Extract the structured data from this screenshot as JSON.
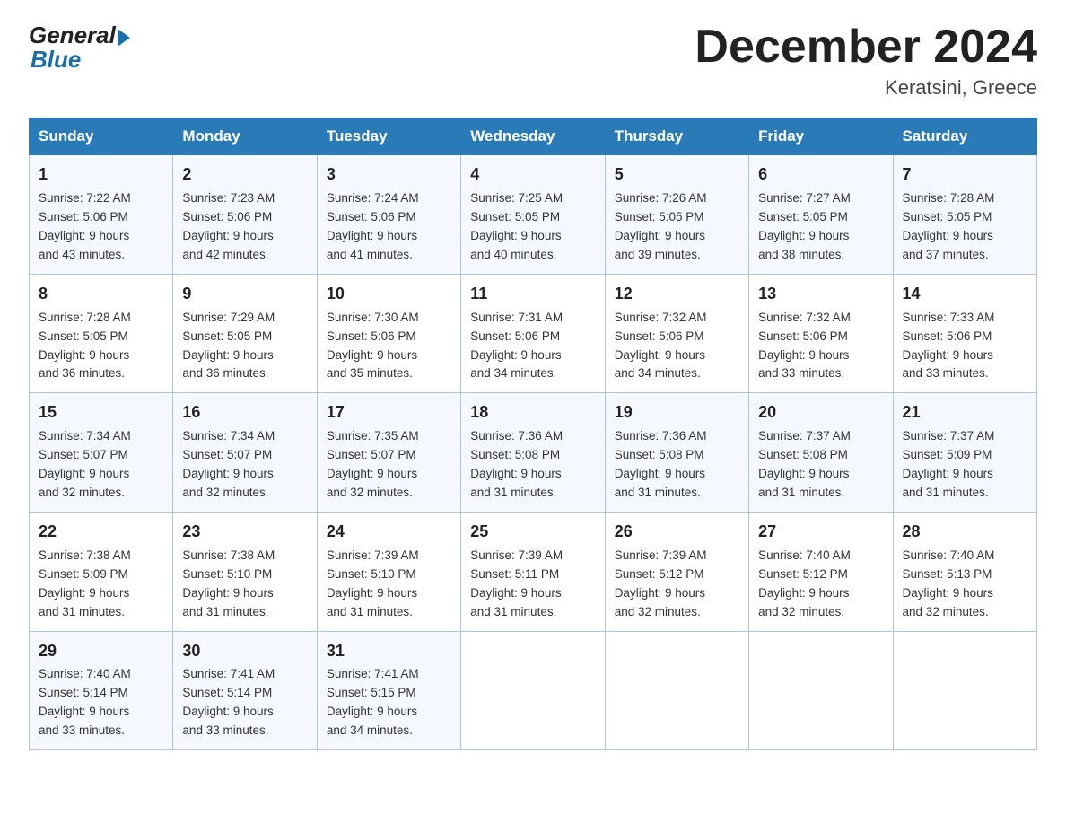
{
  "header": {
    "logo_general": "General",
    "logo_blue": "Blue",
    "month_title": "December 2024",
    "location": "Keratsini, Greece"
  },
  "days_of_week": [
    "Sunday",
    "Monday",
    "Tuesday",
    "Wednesday",
    "Thursday",
    "Friday",
    "Saturday"
  ],
  "weeks": [
    [
      {
        "day": "1",
        "sunrise": "7:22 AM",
        "sunset": "5:06 PM",
        "daylight": "9 hours and 43 minutes."
      },
      {
        "day": "2",
        "sunrise": "7:23 AM",
        "sunset": "5:06 PM",
        "daylight": "9 hours and 42 minutes."
      },
      {
        "day": "3",
        "sunrise": "7:24 AM",
        "sunset": "5:06 PM",
        "daylight": "9 hours and 41 minutes."
      },
      {
        "day": "4",
        "sunrise": "7:25 AM",
        "sunset": "5:05 PM",
        "daylight": "9 hours and 40 minutes."
      },
      {
        "day": "5",
        "sunrise": "7:26 AM",
        "sunset": "5:05 PM",
        "daylight": "9 hours and 39 minutes."
      },
      {
        "day": "6",
        "sunrise": "7:27 AM",
        "sunset": "5:05 PM",
        "daylight": "9 hours and 38 minutes."
      },
      {
        "day": "7",
        "sunrise": "7:28 AM",
        "sunset": "5:05 PM",
        "daylight": "9 hours and 37 minutes."
      }
    ],
    [
      {
        "day": "8",
        "sunrise": "7:28 AM",
        "sunset": "5:05 PM",
        "daylight": "9 hours and 36 minutes."
      },
      {
        "day": "9",
        "sunrise": "7:29 AM",
        "sunset": "5:05 PM",
        "daylight": "9 hours and 36 minutes."
      },
      {
        "day": "10",
        "sunrise": "7:30 AM",
        "sunset": "5:06 PM",
        "daylight": "9 hours and 35 minutes."
      },
      {
        "day": "11",
        "sunrise": "7:31 AM",
        "sunset": "5:06 PM",
        "daylight": "9 hours and 34 minutes."
      },
      {
        "day": "12",
        "sunrise": "7:32 AM",
        "sunset": "5:06 PM",
        "daylight": "9 hours and 34 minutes."
      },
      {
        "day": "13",
        "sunrise": "7:32 AM",
        "sunset": "5:06 PM",
        "daylight": "9 hours and 33 minutes."
      },
      {
        "day": "14",
        "sunrise": "7:33 AM",
        "sunset": "5:06 PM",
        "daylight": "9 hours and 33 minutes."
      }
    ],
    [
      {
        "day": "15",
        "sunrise": "7:34 AM",
        "sunset": "5:07 PM",
        "daylight": "9 hours and 32 minutes."
      },
      {
        "day": "16",
        "sunrise": "7:34 AM",
        "sunset": "5:07 PM",
        "daylight": "9 hours and 32 minutes."
      },
      {
        "day": "17",
        "sunrise": "7:35 AM",
        "sunset": "5:07 PM",
        "daylight": "9 hours and 32 minutes."
      },
      {
        "day": "18",
        "sunrise": "7:36 AM",
        "sunset": "5:08 PM",
        "daylight": "9 hours and 31 minutes."
      },
      {
        "day": "19",
        "sunrise": "7:36 AM",
        "sunset": "5:08 PM",
        "daylight": "9 hours and 31 minutes."
      },
      {
        "day": "20",
        "sunrise": "7:37 AM",
        "sunset": "5:08 PM",
        "daylight": "9 hours and 31 minutes."
      },
      {
        "day": "21",
        "sunrise": "7:37 AM",
        "sunset": "5:09 PM",
        "daylight": "9 hours and 31 minutes."
      }
    ],
    [
      {
        "day": "22",
        "sunrise": "7:38 AM",
        "sunset": "5:09 PM",
        "daylight": "9 hours and 31 minutes."
      },
      {
        "day": "23",
        "sunrise": "7:38 AM",
        "sunset": "5:10 PM",
        "daylight": "9 hours and 31 minutes."
      },
      {
        "day": "24",
        "sunrise": "7:39 AM",
        "sunset": "5:10 PM",
        "daylight": "9 hours and 31 minutes."
      },
      {
        "day": "25",
        "sunrise": "7:39 AM",
        "sunset": "5:11 PM",
        "daylight": "9 hours and 31 minutes."
      },
      {
        "day": "26",
        "sunrise": "7:39 AM",
        "sunset": "5:12 PM",
        "daylight": "9 hours and 32 minutes."
      },
      {
        "day": "27",
        "sunrise": "7:40 AM",
        "sunset": "5:12 PM",
        "daylight": "9 hours and 32 minutes."
      },
      {
        "day": "28",
        "sunrise": "7:40 AM",
        "sunset": "5:13 PM",
        "daylight": "9 hours and 32 minutes."
      }
    ],
    [
      {
        "day": "29",
        "sunrise": "7:40 AM",
        "sunset": "5:14 PM",
        "daylight": "9 hours and 33 minutes."
      },
      {
        "day": "30",
        "sunrise": "7:41 AM",
        "sunset": "5:14 PM",
        "daylight": "9 hours and 33 minutes."
      },
      {
        "day": "31",
        "sunrise": "7:41 AM",
        "sunset": "5:15 PM",
        "daylight": "9 hours and 34 minutes."
      },
      null,
      null,
      null,
      null
    ]
  ],
  "labels": {
    "sunrise": "Sunrise:",
    "sunset": "Sunset:",
    "daylight": "Daylight:"
  }
}
